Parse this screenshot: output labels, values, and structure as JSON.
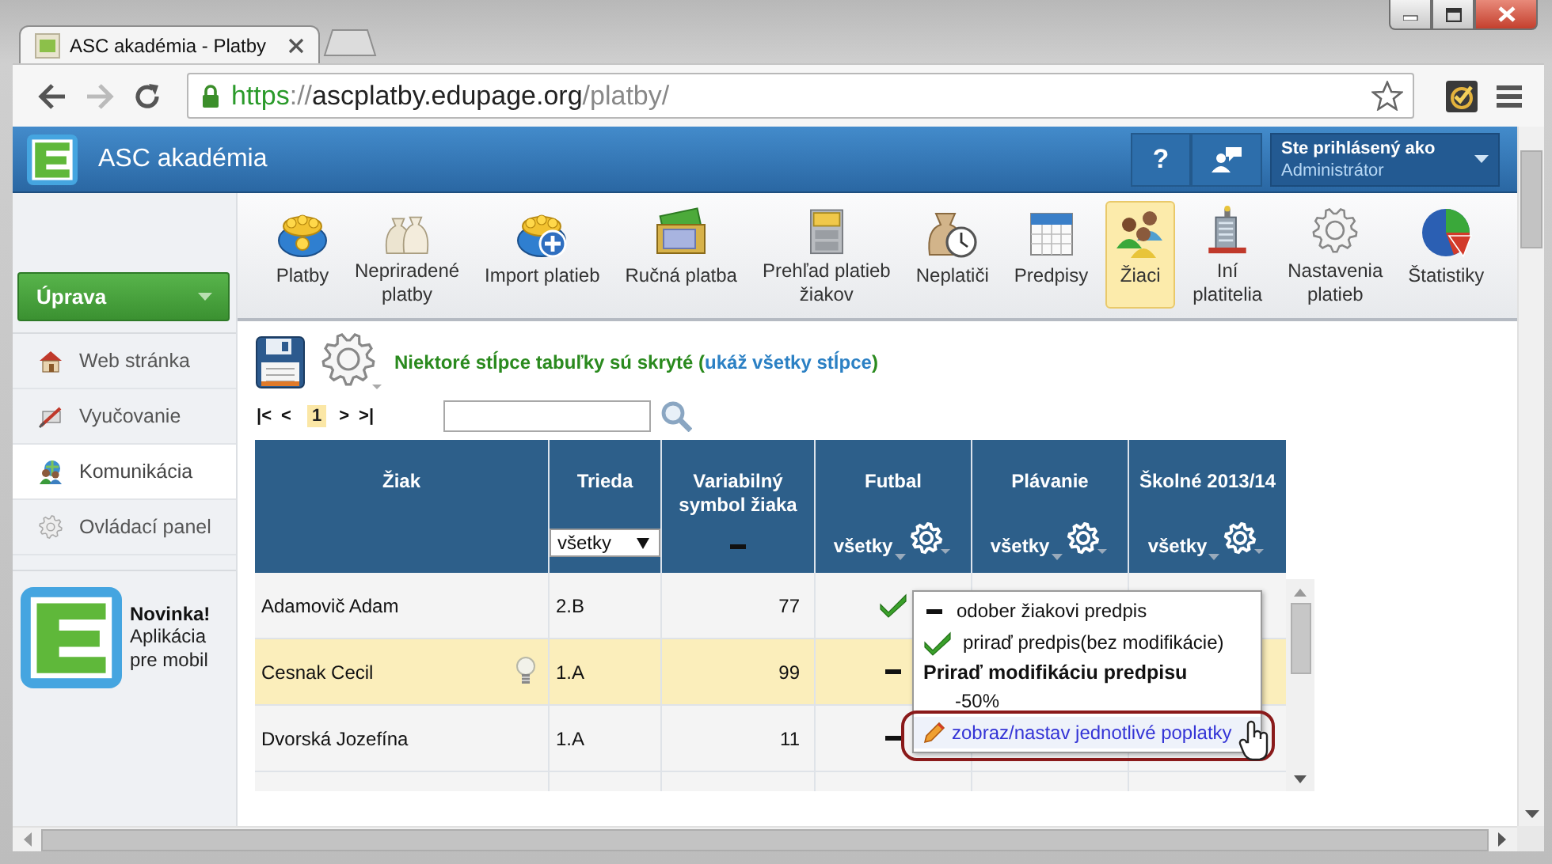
{
  "browser": {
    "tab_title": "ASC akadémia - Platby",
    "url": [
      {
        "text": "https",
        "kind": "secure"
      },
      {
        "text": "://",
        "kind": "dim"
      },
      {
        "text": "ascplatby.edupage.org",
        "kind": "host"
      },
      {
        "text": "/platby/",
        "kind": "dim"
      }
    ]
  },
  "header": {
    "title": "ASC akadémia",
    "help": "?",
    "user_caption": "Ste prihlásený ako",
    "user_name": "Administrátor"
  },
  "sidebar": {
    "menu_button": "Úprava",
    "items": [
      {
        "label": "Web stránka",
        "selected": false
      },
      {
        "label": "Vyučovanie",
        "selected": false
      },
      {
        "label": "Komunikácia",
        "selected": true
      },
      {
        "label": "Ovládací panel",
        "selected": false
      }
    ],
    "promo": {
      "title": "Novinka!",
      "text": "Aplikácia pre mobil"
    }
  },
  "toolbar": [
    {
      "label": "Platby",
      "selected": false
    },
    {
      "label": "Nepriradené\nplatby",
      "selected": false
    },
    {
      "label": "Import platieb",
      "selected": false
    },
    {
      "label": "Ručná platba",
      "selected": false
    },
    {
      "label": "Prehľad platieb\nžiakov",
      "selected": false
    },
    {
      "label": "Neplatiči",
      "selected": false
    },
    {
      "label": "Predpisy",
      "selected": false
    },
    {
      "label": "Žiaci",
      "selected": true
    },
    {
      "label": "Iní\nplatitelia",
      "selected": false
    },
    {
      "label": "Nastavenia\nplatieb",
      "selected": false
    },
    {
      "label": "Štatistiky",
      "selected": false
    }
  ],
  "notice": {
    "text_before": "Niektoré stĺpce tabuľky sú skryté (",
    "link": "ukáž všetky stĺpce",
    "text_after": ")"
  },
  "pager": {
    "first": "|<",
    "previous": "<",
    "page": "1",
    "next": ">",
    "last": ">|"
  },
  "table": {
    "columns": [
      {
        "title": "Žiak"
      },
      {
        "title": "Trieda",
        "filter": {
          "kind": "select",
          "label": "všetky"
        }
      },
      {
        "title": "Variabilný symbol žiaka",
        "filter": {
          "kind": "dash"
        }
      },
      {
        "title": "Futbal",
        "filter": {
          "kind": "menu",
          "label": "všetky"
        }
      },
      {
        "title": "Plávanie",
        "filter": {
          "kind": "menu",
          "label": "všetky"
        }
      },
      {
        "title": "Školné 2013/14",
        "filter": {
          "kind": "menu",
          "label": "všetky"
        }
      }
    ],
    "rows": [
      {
        "student": "Adamovič Adam",
        "class": "2.B",
        "symbol": "77",
        "futbal": {
          "kind": "check"
        },
        "selected": false,
        "hint": false
      },
      {
        "student": "Cesnak Cecil",
        "class": "1.A",
        "symbol": "99",
        "futbal": {
          "kind": "minus"
        },
        "selected": true,
        "hint": true
      },
      {
        "student": "Dvorská Jozefína",
        "class": "1.A",
        "symbol": "11",
        "futbal": {
          "kind": "minus"
        },
        "selected": false,
        "hint": false
      }
    ]
  },
  "popup": {
    "items": [
      {
        "kind": "minus",
        "label": "odober žiakovi predpis",
        "selected": false
      },
      {
        "kind": "check",
        "label": "priraď predpis(bez modifikácie)",
        "selected": false
      },
      {
        "kind": "heading",
        "label": "Priraď modifikáciu predpisu",
        "selected": false
      },
      {
        "kind": "option",
        "label": "-50%",
        "selected": false
      },
      {
        "kind": "edit",
        "label": "zobraz/nastav jednotlivé poplatky",
        "selected": true
      }
    ]
  }
}
